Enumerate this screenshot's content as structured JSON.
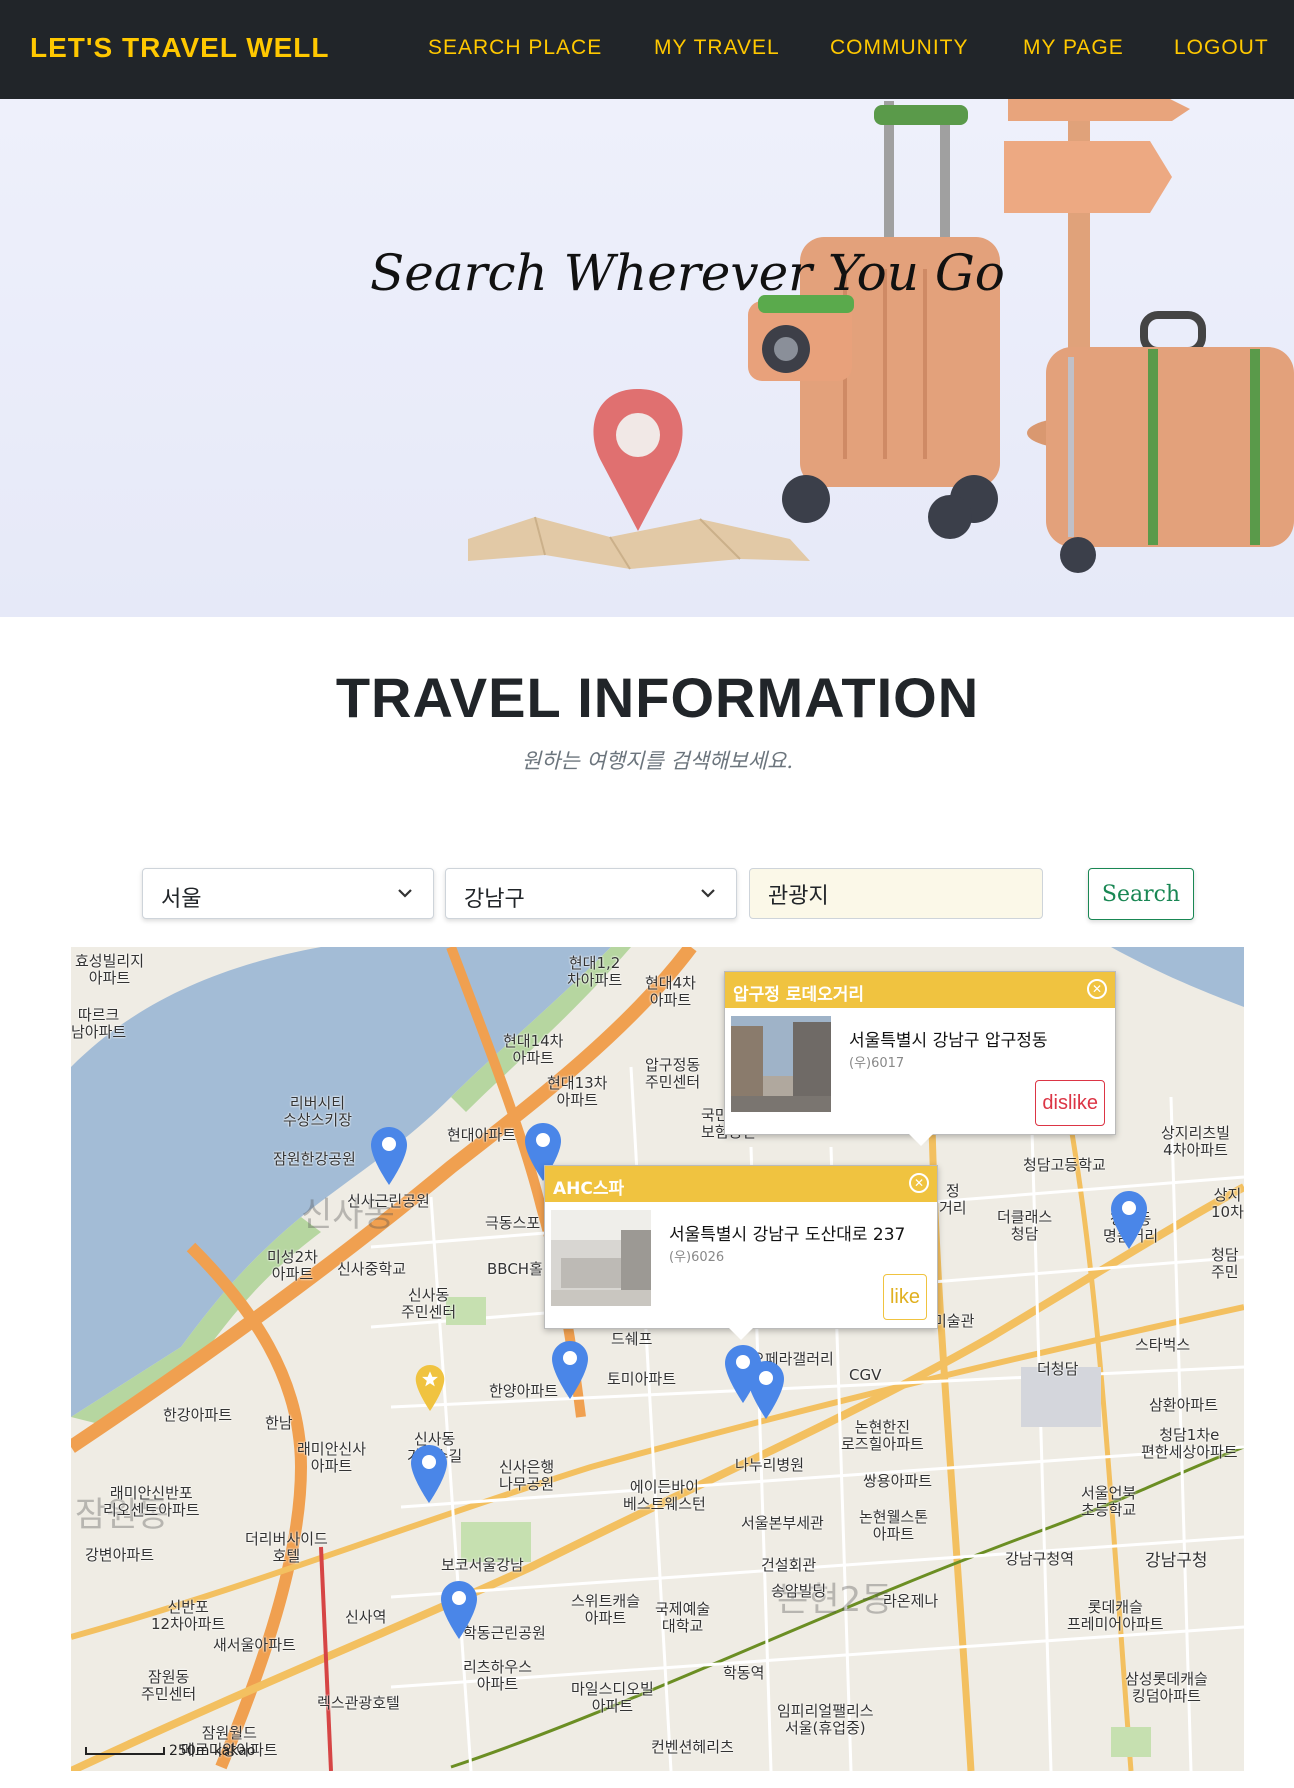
{
  "navbar": {
    "brand": "LET'S TRAVEL WELL",
    "links": [
      "SEARCH PLACE",
      "MY TRAVEL",
      "COMMUNITY",
      "MY PAGE",
      "LOGOUT"
    ],
    "accent_color": "#ffc800",
    "background_color": "#212529"
  },
  "hero": {
    "title": "Search Wherever You Go"
  },
  "section": {
    "title": "TRAVEL INFORMATION",
    "subtitle": "원하는 여행지를 검색해보세요."
  },
  "search": {
    "region": "서울",
    "district": "강남구",
    "keyword": "관광지",
    "button": "Search",
    "button_color": "#198754"
  },
  "map": {
    "labels": [
      "효성빌리지\n아파트",
      "현대1,2\n차아파트",
      "현대4차\n아파트",
      "따르크\n남아파트",
      "현대14차\n아파트",
      "압구정동\n주민센터",
      "현대13차\n아파트",
      "리버시티\n수상스키장",
      "국민은행\n보험공단",
      "현대아파트",
      "잠원한강공원",
      "신사근린공원",
      "극동스포",
      "미성2차\n아파트",
      "신사중학교",
      "BBCH홀",
      "신사동\n주민센터",
      "한강아파트",
      "한남",
      "드쉐프",
      "토미아파트",
      "한양아파트",
      "래미안신사\n아파트",
      "신사은행\n나무공원",
      "래미안신반포\n리오센트아파트",
      "더리버사이드\n호텔",
      "강변아파트",
      "에이든바이\n베스트웨스턴",
      "나누리병원",
      "쌍용아파트",
      "신반포\n12차아파트",
      "신사역",
      "보코서울강남",
      "서울본부세관",
      "논현웰스톤\n아파트",
      "건설회관",
      "송암빌딩",
      "새서울아파트",
      "학동근린공원",
      "스위트캐슬\n아파트",
      "국제예술\n대학교",
      "라온제나",
      "잠원동\n주민센터",
      "리츠하우스\n아파트",
      "렉스관광호텔",
      "마일스디오빌\n아파트",
      "임피리얼팰리스\n서울(휴업중)",
      "잠원월드\n메르디앙아파트",
      "컨벤션헤리츠",
      "학동역",
      "논현한진\n로즈힐아파트",
      "CGV",
      "미술관",
      "오페라갤러리",
      "더청담",
      "스타벅스",
      "삼환아파트",
      "청담1차e\n편한세상아파트",
      "서울언북\n초등학교",
      "강남구청역",
      "강남구청",
      "롯데캐슬\n프레미어아파트",
      "삼성롯데캐슬\n킹덤아파트",
      "청담고등학교",
      "더클래스\n청담",
      "청담동\n명품거리",
      "상지리츠빌\n4차아파트",
      "상지\n10차",
      "청담\n주민",
      "신사동\n가로수길",
      "정\n거리"
    ],
    "area_labels": [
      "신사동",
      "잠원동",
      "논현2동"
    ],
    "scale_text": "250m",
    "provider": "kakao"
  },
  "infowindows": [
    {
      "title": "압구정 로데오거리",
      "address": "서울특별시 강남구 압구정동",
      "zip": "(우)6017",
      "action": "dislike"
    },
    {
      "title": "AHC스파",
      "address": "서울특별시 강남구 도산대로 237",
      "zip": "(우)6026",
      "action": "like"
    }
  ],
  "colors": {
    "marker": "#4a86e8",
    "infowindow_header": "#f0c340",
    "dislike": "#dc3545",
    "like": "#e0b020",
    "river": "#a3bcd6",
    "major_road": "#f0a050"
  }
}
